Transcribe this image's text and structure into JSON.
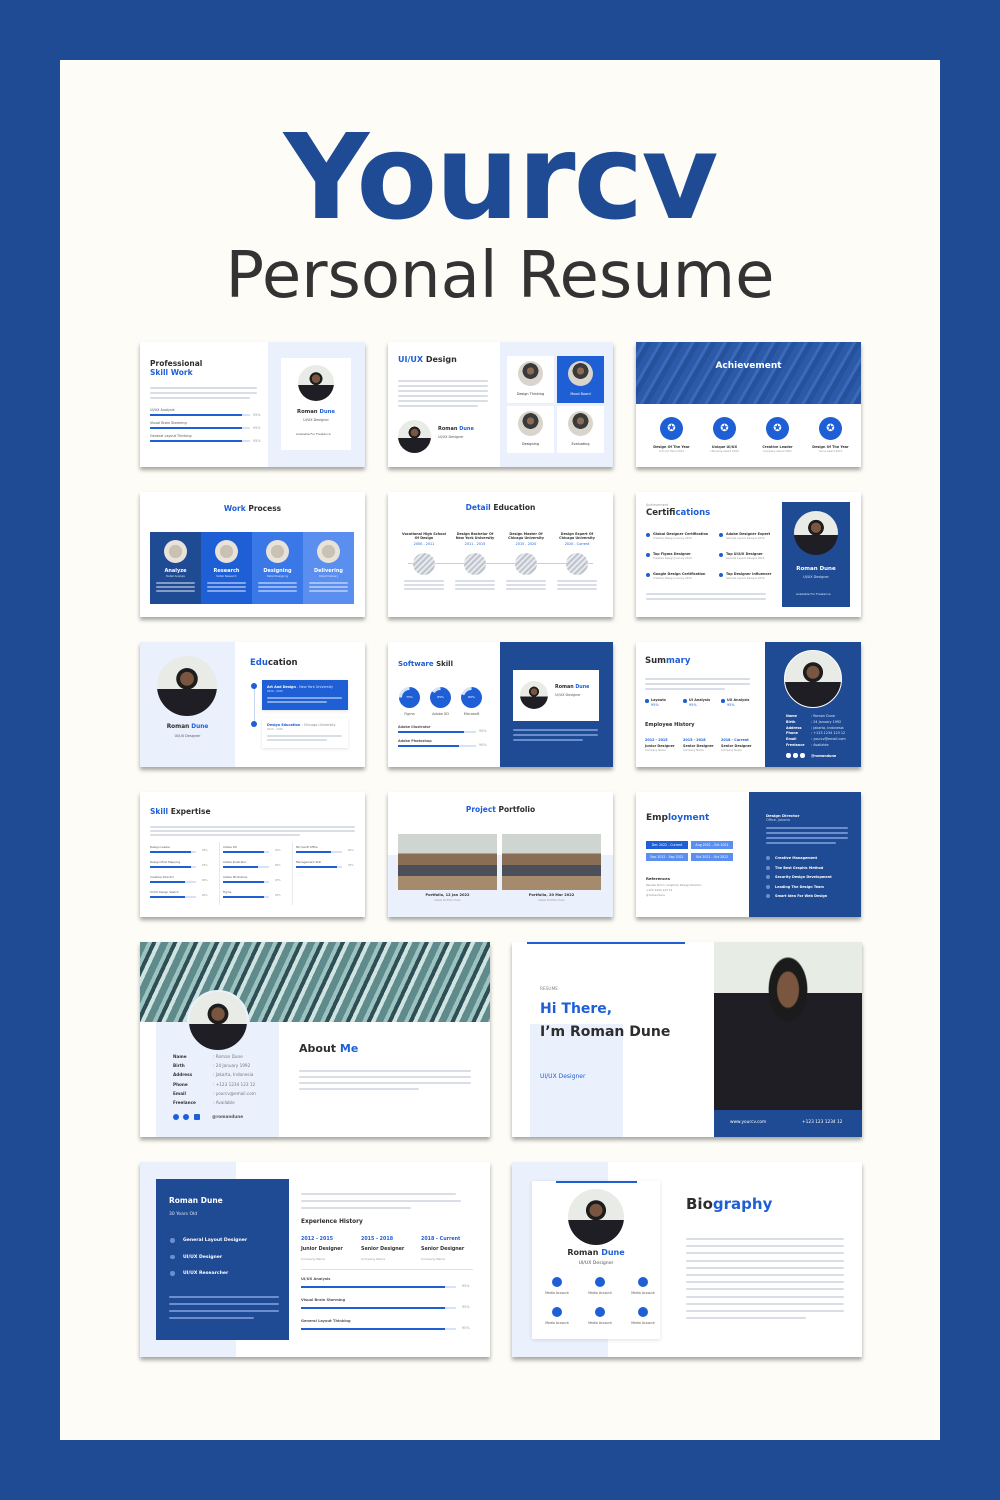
{
  "header": {
    "brand": "Yourcv",
    "subtitle": "Personal Resume"
  },
  "colors": {
    "brand_blue": "#1f4a94",
    "accent_blue": "#1e5fd6",
    "pale_blue": "#eaf1fd",
    "sheet": "#fdfcf6"
  },
  "person": {
    "first": "Roman",
    "last": "Dune",
    "role": "UI/UX Designer",
    "status": "Available For Freelance"
  },
  "slides": {
    "professional": {
      "title1": "Professional",
      "title2": "Skill Work",
      "skills": [
        {
          "label": "UI/UX Analysis",
          "value": "95%",
          "pct": 0.92
        },
        {
          "label": "Visual Brain Storming",
          "value": "95%",
          "pct": 0.92
        },
        {
          "label": "General Layout Thinking",
          "value": "95%",
          "pct": 0.92
        }
      ]
    },
    "uiux": {
      "title_a": "UI/UX",
      "title_b": " Design",
      "tiles": [
        "Design Thinking",
        "Mood Board",
        "Designing",
        "Evaluating"
      ]
    },
    "achievement": {
      "title": "Achievement",
      "items": [
        {
          "label": "Design Of The Year",
          "sub": "Lid Lind Hand 2021"
        },
        {
          "label": "Unique UI/UX",
          "sub": "Lithuania Award 2020"
        },
        {
          "label": "Creative Leader",
          "sub": "Company Award 2021"
        },
        {
          "label": "Design Of The Year",
          "sub": "Lacus Award 2021"
        }
      ]
    },
    "work_process": {
      "title_a": "Work",
      "title_b": " Process",
      "steps": [
        {
          "label": "Analyze",
          "sub": "Detail Analyze"
        },
        {
          "label": "Research",
          "sub": "Detail Research"
        },
        {
          "label": "Designing",
          "sub": "Detail Designing"
        },
        {
          "label": "Delivering",
          "sub": "Detail Delivery"
        }
      ]
    },
    "detail_education": {
      "title_a": "Detail",
      "title_b": " Education",
      "items": [
        {
          "label": "Vocational High School Of Design",
          "years": "2000 - 2011"
        },
        {
          "label": "Design Bachelor Of New York University",
          "years": "2011 - 2015"
        },
        {
          "label": "Design Master Of Chicago University",
          "years": "2015 - 2020"
        },
        {
          "label": "Design Expert Of Chicago University",
          "years": "2020 - Current"
        }
      ]
    },
    "certifications": {
      "kicker": "Achievement",
      "title_a": "Certif",
      "title_b": "ications",
      "items": [
        {
          "label": "Global Designer Certification",
          "sub": "Creative Design Journey 2019"
        },
        {
          "label": "Adobe Designer Expert",
          "sub": "General Layout Designs 2019"
        },
        {
          "label": "Top Figma Designer",
          "sub": "Creative Design Journey 2019"
        },
        {
          "label": "Top UI/UX Designer",
          "sub": "General Layout Designs 2019"
        },
        {
          "label": "Google Design Certification",
          "sub": "Creative Design Journey 2019"
        },
        {
          "label": "Top Designer Influencer",
          "sub": "General Layout Designs 2019"
        }
      ]
    },
    "education": {
      "title_a": "Edu",
      "title_b": "cation",
      "items": [
        {
          "label": "Art And Design",
          "school": " - New York University",
          "years": "2010 - 2015"
        },
        {
          "label": "Design Education",
          "school": " - Chicago University",
          "years": "2015 - 2020"
        }
      ]
    },
    "software": {
      "title_a": "Software",
      "title_b": " Skill",
      "rings": [
        {
          "label": "Figma",
          "value": "75%",
          "pct": 0.75
        },
        {
          "label": "Adobe XD",
          "value": "85%",
          "pct": 0.85
        },
        {
          "label": "Microsoft",
          "value": "80%",
          "pct": 0.8
        }
      ],
      "bars": [
        {
          "label": "Adobe Illustrator",
          "value": "95%",
          "pct": 0.85
        },
        {
          "label": "Adobe Photoshop",
          "value": "90%",
          "pct": 0.78
        }
      ]
    },
    "summary": {
      "title_a": "Sum",
      "title_b": "mary",
      "skills": [
        {
          "label": "Layouts",
          "value": "95%"
        },
        {
          "label": "UI Analysis",
          "value": "95%"
        },
        {
          "label": "UX Analysis",
          "value": "95%"
        }
      ],
      "history_title": "Employee History",
      "history": [
        {
          "years": "2012 - 2015",
          "role": "Junior Designer",
          "company": "Company Name"
        },
        {
          "years": "2015 - 2018",
          "role": "Senior Designer",
          "company": "Company Name"
        },
        {
          "years": "2018 - Current",
          "role": "Senior Designer",
          "company": "Company Name"
        }
      ],
      "info": [
        [
          "Name",
          ": Roman Dune"
        ],
        [
          "Birth",
          ": 24 January 1992"
        ],
        [
          "Address",
          ": Jakarta, Indonesia"
        ],
        [
          "Phone",
          ": +123 1234 123 12"
        ],
        [
          "Email",
          ": yourcv@email.com"
        ],
        [
          "Freelance",
          ": Available"
        ]
      ],
      "handle": "@romandune"
    },
    "skill_expertise": {
      "title_a": "Skill",
      "title_b": " Expertise",
      "columns": [
        [
          {
            "label": "Design Leader",
            "value": "95%",
            "pct": 0.9
          },
          {
            "label": "Design Mind Mapping",
            "value": "95%",
            "pct": 0.9
          },
          {
            "label": "Creative Director",
            "value": "80%",
            "pct": 0.75
          },
          {
            "label": "UI/UX Design Sketch",
            "value": "80%",
            "pct": 0.75
          }
        ],
        [
          {
            "label": "Adobe XD",
            "value": "95%",
            "pct": 0.9
          },
          {
            "label": "Adobe Illustrator",
            "value": "80%",
            "pct": 0.75
          },
          {
            "label": "Adobe Photoshop",
            "value": "95%",
            "pct": 0.9
          },
          {
            "label": "Figma",
            "value": "95%",
            "pct": 0.9
          }
        ],
        [
          {
            "label": "Microsoft Office",
            "value": "80%",
            "pct": 0.75
          },
          {
            "label": "Management Skill",
            "value": "95%",
            "pct": 0.9
          }
        ]
      ]
    },
    "portfolio": {
      "title_a": "Project",
      "title_b": " Portfolio",
      "items": [
        {
          "label": "Portfolio, 12 Jan 2022",
          "sub": "Detail Portfolio Here"
        },
        {
          "label": "Portfolio, 20 Mar 2022",
          "sub": "Detail Portfolio Here"
        }
      ]
    },
    "employment": {
      "title_a": "Emp",
      "title_b": "loyment",
      "periods": [
        "Dec 2022 - Current",
        "Aug 2021 - Oct 2021",
        "Sep 2012 - Sep 2021",
        "Oct 2021 - Oct 2022"
      ],
      "references_title": "References",
      "references": [
        "Renata Sumo, Graphics Design Director",
        "+123 1234 123 12",
        "@romandune"
      ],
      "job_title": "Design Director",
      "job_sub": "Office, Jakarta",
      "bullets": [
        "Creative Management",
        "The Best Graphic Method",
        "Security Design Development",
        "Leading The Design Team",
        "Smart Idea For Web Design"
      ]
    },
    "about": {
      "title_a": "About",
      "title_b": " Me",
      "info": [
        [
          "Name",
          ": Roman Dune"
        ],
        [
          "Birth",
          ": 24 January 1992"
        ],
        [
          "Address",
          ": Jakarta, Indonesia"
        ],
        [
          "Phone",
          ": +123 1234 123 12"
        ],
        [
          "Email",
          ": yourcv@email.com"
        ],
        [
          "Freelance",
          ": Available"
        ]
      ],
      "handle": "@romandune"
    },
    "hero": {
      "kicker": "RESUME",
      "line1": "Hi There,",
      "line2": "I’m Roman Dune",
      "role": "UI/UX Designer",
      "website": "www.yourcv.com",
      "phone": "+123 123 1234 12"
    },
    "profile": {
      "name": "Roman Dune",
      "age": "30 Years Old",
      "roles": [
        "General Layout Designer",
        "UI/UX Designer",
        "UI/UX Researcher"
      ],
      "history_title": "Experience History",
      "history": [
        {
          "years": "2012 - 2015",
          "role": "Junior Designer",
          "company": "Company Name"
        },
        {
          "years": "2015 - 2018",
          "role": "Senior Designer",
          "company": "Company Name"
        },
        {
          "years": "2018 - Current",
          "role": "Senior Designer",
          "company": "Company Name"
        }
      ],
      "skills": [
        {
          "label": "UI/UX Analysis",
          "value": "95%",
          "pct": 0.93
        },
        {
          "label": "Visual Brain Storming",
          "value": "95%",
          "pct": 0.93
        },
        {
          "label": "General Layout Thinking",
          "value": "95%",
          "pct": 0.93
        }
      ]
    },
    "biography": {
      "title_a": "Bio",
      "title_b": "graphy",
      "media_label": "Media Account",
      "media_icons": [
        "twitter",
        "facebook",
        "linkedin",
        "instagram",
        "linkedin",
        "messenger"
      ]
    }
  }
}
